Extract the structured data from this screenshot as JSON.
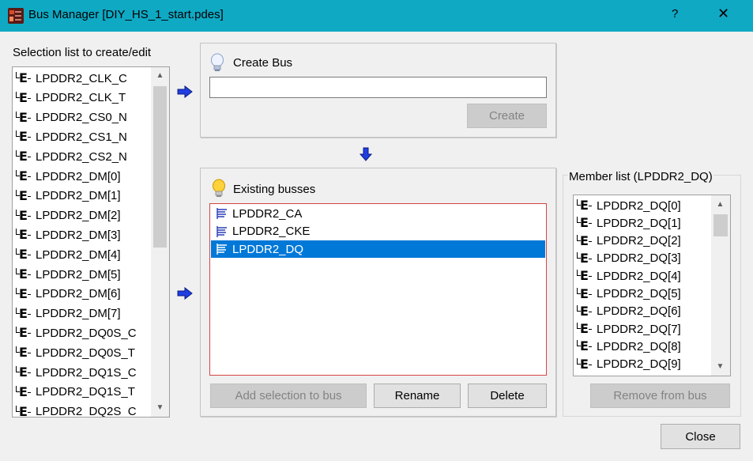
{
  "window": {
    "title": "Bus Manager [DIY_HS_1_start.pdes]",
    "help_label": "?",
    "close_label": "✕"
  },
  "selection": {
    "label": "Selection list to create/edit",
    "items": [
      "LPDDR2_CLK_C",
      "LPDDR2_CLK_T",
      "LPDDR2_CS0_N",
      "LPDDR2_CS1_N",
      "LPDDR2_CS2_N",
      "LPDDR2_DM[0]",
      "LPDDR2_DM[1]",
      "LPDDR2_DM[2]",
      "LPDDR2_DM[3]",
      "LPDDR2_DM[4]",
      "LPDDR2_DM[5]",
      "LPDDR2_DM[6]",
      "LPDDR2_DM[7]",
      "LPDDR2_DQ0S_C",
      "LPDDR2_DQ0S_T",
      "LPDDR2_DQ1S_C",
      "LPDDR2_DQ1S_T",
      "LPDDR2_DQ2S_C"
    ]
  },
  "create_bus": {
    "title": "Create Bus",
    "name_value": "",
    "create_label": "Create"
  },
  "existing": {
    "title": "Existing busses",
    "items": [
      "LPDDR2_CA",
      "LPDDR2_CKE",
      "LPDDR2_DQ"
    ],
    "selected": "LPDDR2_DQ",
    "add_label": "Add selection to bus",
    "rename_label": "Rename",
    "delete_label": "Delete"
  },
  "members": {
    "label": "Member list (LPDDR2_DQ)",
    "items": [
      "LPDDR2_DQ[0]",
      "LPDDR2_DQ[1]",
      "LPDDR2_DQ[2]",
      "LPDDR2_DQ[3]",
      "LPDDR2_DQ[4]",
      "LPDDR2_DQ[5]",
      "LPDDR2_DQ[6]",
      "LPDDR2_DQ[7]",
      "LPDDR2_DQ[8]",
      "LPDDR2_DQ[9]"
    ],
    "remove_label": "Remove from bus"
  },
  "footer": {
    "close_label": "Close"
  },
  "colors": {
    "titlebar": "#0fa9c4",
    "selection_highlight": "#0078d7",
    "arrow_blue": "#1f3fe0",
    "listbox_error_border": "#d64545"
  }
}
